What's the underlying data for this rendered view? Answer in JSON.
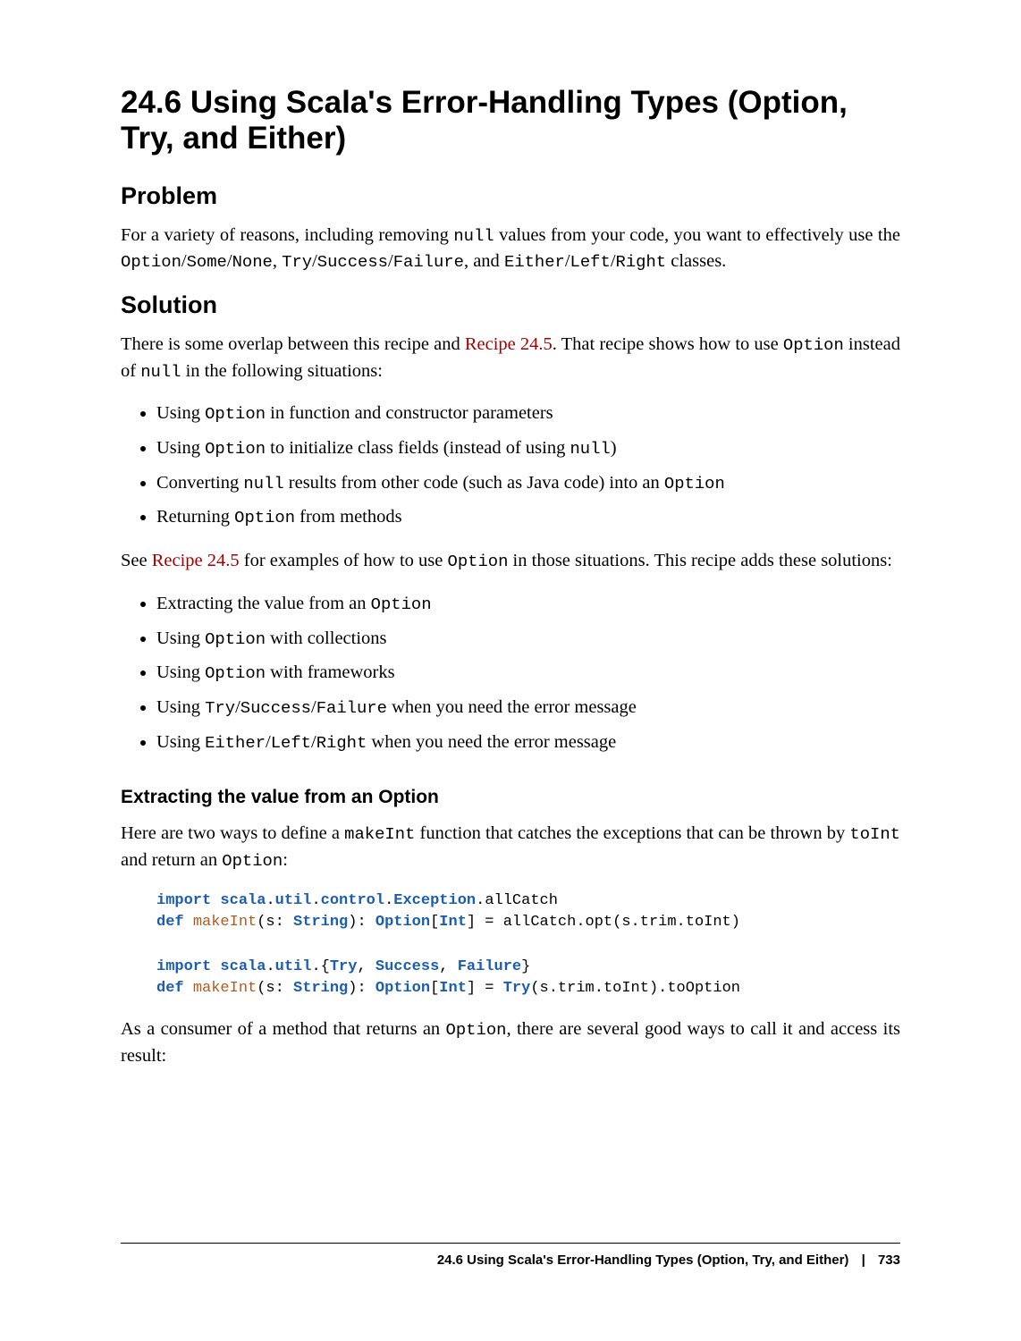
{
  "title": "24.6 Using Scala's Error-Handling Types (Option, Try, and Either)",
  "sections": {
    "problem": {
      "heading": "Problem",
      "para_prefix": "For a variety of reasons, including removing ",
      "code1": "null",
      "para_mid1": " values from your code, you want to effectively use the ",
      "code2": "Option",
      "slash1": "/",
      "code3": "Some",
      "slash2": "/",
      "code4": "None",
      "comma1": ", ",
      "code5": "Try",
      "slash3": "/",
      "code6": "Success",
      "slash4": "/",
      "code7": "Failure",
      "comma2": ", and ",
      "code8": "Either",
      "slash5": "/",
      "code9": "Left",
      "slash6": "/",
      "code10": "Right",
      "para_end": " classes."
    },
    "solution": {
      "heading": "Solution",
      "p1_a": "There is some overlap between this recipe and ",
      "p1_link": "Recipe 24.5",
      "p1_b": ". That recipe shows how to use ",
      "p1_code1": "Option",
      "p1_c": " instead of ",
      "p1_code2": "null",
      "p1_d": " in the following situations:",
      "list1": {
        "i1_a": "Using ",
        "i1_c": "Option",
        "i1_b": " in function and constructor parameters",
        "i2_a": "Using ",
        "i2_c": "Option",
        "i2_b": " to initialize class fields (instead of using ",
        "i2_c2": "null",
        "i2_d": ")",
        "i3_a": "Converting ",
        "i3_c": "null",
        "i3_b": " results from other code (such as Java code) into an ",
        "i3_c2": "Option",
        "i4_a": "Returning ",
        "i4_c": "Option",
        "i4_b": " from methods"
      },
      "p2_a": "See ",
      "p2_link": "Recipe 24.5",
      "p2_b": " for examples of how to use ",
      "p2_code": "Option",
      "p2_c": " in those situations. This recipe adds these solutions:",
      "list2": {
        "i1_a": "Extracting the value from an ",
        "i1_c": "Option",
        "i2_a": "Using ",
        "i2_c": "Option",
        "i2_b": " with collections",
        "i3_a": "Using ",
        "i3_c": "Option",
        "i3_b": " with frameworks",
        "i4_a": "Using ",
        "i4_c": "Try",
        "i4_s1": "/",
        "i4_c2": "Success",
        "i4_s2": "/",
        "i4_c3": "Failure",
        "i4_b": " when you need the error message",
        "i5_a": "Using ",
        "i5_c": "Either",
        "i5_s1": "/",
        "i5_c2": "Left",
        "i5_s2": "/",
        "i5_c3": "Right",
        "i5_b": " when you need the error message"
      }
    },
    "extracting": {
      "heading": "Extracting the value from an Option",
      "p1_a": "Here are two ways to define a ",
      "p1_code1": "makeInt",
      "p1_b": " function that catches the exceptions that can be thrown by ",
      "p1_code2": "toInt",
      "p1_c": " and return an ",
      "p1_code3": "Option",
      "p1_d": ":",
      "code": {
        "l1": {
          "kw": "import",
          "pkg1": "scala",
          "dot1": ".",
          "pkg2": "util",
          "dot2": ".",
          "pkg3": "control",
          "dot3": ".",
          "pkg4": "Exception",
          "dot4": ".",
          "rest": "allCatch"
        },
        "l2": {
          "kw": "def",
          "fn": "makeInt",
          "sig_a": "(s: ",
          "typ1": "String",
          "sig_b": "): ",
          "typ2": "Option",
          "sig_c": "[",
          "typ3": "Int",
          "sig_d": "] = allCatch.opt(s.trim.toInt)"
        },
        "l3": {
          "kw": "import",
          "pkg1": "scala",
          "dot1": ".",
          "pkg2": "util",
          "dot2": ".",
          "br_o": "{",
          "t1": "Try",
          "c1": ", ",
          "t2": "Success",
          "c2": ", ",
          "t3": "Failure",
          "br_c": "}"
        },
        "l4": {
          "kw": "def",
          "fn": "makeInt",
          "sig_a": "(s: ",
          "typ1": "String",
          "sig_b": "): ",
          "typ2": "Option",
          "sig_c": "[",
          "typ3": "Int",
          "sig_d": "] = ",
          "typ4": "Try",
          "rest": "(s.trim.toInt).toOption"
        }
      },
      "p2_a": "As a consumer of a method that returns an ",
      "p2_code": "Option",
      "p2_b": ", there are several good ways to call it and access its result:"
    }
  },
  "footer": {
    "title": "24.6 Using Scala's Error-Handling Types (Option, Try, and Either)",
    "sep": "|",
    "page": "733"
  }
}
